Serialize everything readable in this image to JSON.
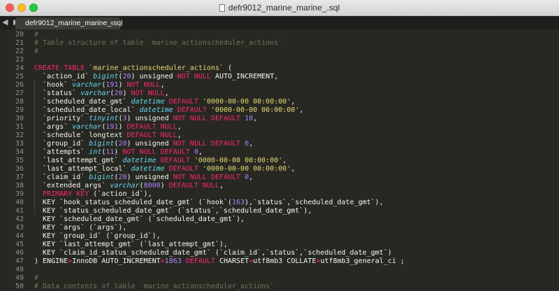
{
  "window": {
    "title": "defr9012_marine_marine_.sql",
    "tab_label": "defr9012_marine_marine_.sql",
    "tab_close": "×",
    "nav_arrows": "◀ ▶"
  },
  "colors": {
    "background": "#272822",
    "comment": "#75715e",
    "keyword": "#f92672",
    "type": "#66d9ef",
    "number": "#ae81ff",
    "string": "#e6db74",
    "text": "#f8f8f2",
    "line_number": "#90908a"
  },
  "code_lines": [
    {
      "n": "20",
      "tokens": [
        {
          "c": "comment",
          "t": "#"
        }
      ]
    },
    {
      "n": "21",
      "tokens": [
        {
          "c": "comment",
          "t": "# Table structure of table `marine_actionscheduler_actions`"
        }
      ]
    },
    {
      "n": "22",
      "tokens": [
        {
          "c": "comment",
          "t": "#"
        }
      ]
    },
    {
      "n": "23",
      "tokens": []
    },
    {
      "n": "24",
      "tokens": [
        {
          "c": "kw",
          "t": "CREATE TABLE "
        },
        {
          "c": "str",
          "t": "`marine_actionscheduler_actions`"
        },
        {
          "c": "plain",
          "t": " ("
        }
      ]
    },
    {
      "n": "25",
      "tokens": [
        {
          "c": "plain",
          "t": "  `action_id` "
        },
        {
          "c": "type",
          "t": "bigint"
        },
        {
          "c": "plain",
          "t": "("
        },
        {
          "c": "num",
          "t": "20"
        },
        {
          "c": "plain",
          "t": ") unsigned "
        },
        {
          "c": "kw",
          "t": "NOT NULL"
        },
        {
          "c": "plain",
          "t": " AUTO_INCREMENT,"
        }
      ]
    },
    {
      "n": "26",
      "tokens": [
        {
          "c": "plain",
          "t": "  `hook` "
        },
        {
          "c": "type",
          "t": "varchar"
        },
        {
          "c": "plain",
          "t": "("
        },
        {
          "c": "num",
          "t": "191"
        },
        {
          "c": "plain",
          "t": ") "
        },
        {
          "c": "kw",
          "t": "NOT NULL"
        },
        {
          "c": "plain",
          "t": ","
        }
      ]
    },
    {
      "n": "27",
      "tokens": [
        {
          "c": "plain",
          "t": "  `status` "
        },
        {
          "c": "type",
          "t": "varchar"
        },
        {
          "c": "plain",
          "t": "("
        },
        {
          "c": "num",
          "t": "20"
        },
        {
          "c": "plain",
          "t": ") "
        },
        {
          "c": "kw",
          "t": "NOT NULL"
        },
        {
          "c": "plain",
          "t": ","
        }
      ]
    },
    {
      "n": "28",
      "tokens": [
        {
          "c": "plain",
          "t": "  `scheduled_date_gmt` "
        },
        {
          "c": "type",
          "t": "datetime"
        },
        {
          "c": "plain",
          "t": " "
        },
        {
          "c": "kw",
          "t": "DEFAULT"
        },
        {
          "c": "plain",
          "t": " "
        },
        {
          "c": "str",
          "t": "'0000-00-00 00:00:00'"
        },
        {
          "c": "plain",
          "t": ","
        }
      ]
    },
    {
      "n": "29",
      "tokens": [
        {
          "c": "plain",
          "t": "  `scheduled_date_local` "
        },
        {
          "c": "type",
          "t": "datetime"
        },
        {
          "c": "plain",
          "t": " "
        },
        {
          "c": "kw",
          "t": "DEFAULT"
        },
        {
          "c": "plain",
          "t": " "
        },
        {
          "c": "str",
          "t": "'0000-00-00 00:00:00'"
        },
        {
          "c": "plain",
          "t": ","
        }
      ]
    },
    {
      "n": "30",
      "tokens": [
        {
          "c": "plain",
          "t": "  `priority` "
        },
        {
          "c": "type",
          "t": "tinyint"
        },
        {
          "c": "plain",
          "t": "("
        },
        {
          "c": "num",
          "t": "3"
        },
        {
          "c": "plain",
          "t": ") unsigned "
        },
        {
          "c": "kw",
          "t": "NOT NULL DEFAULT"
        },
        {
          "c": "plain",
          "t": " "
        },
        {
          "c": "num",
          "t": "10"
        },
        {
          "c": "plain",
          "t": ","
        }
      ]
    },
    {
      "n": "31",
      "tokens": [
        {
          "c": "plain",
          "t": "  `args` "
        },
        {
          "c": "type",
          "t": "varchar"
        },
        {
          "c": "plain",
          "t": "("
        },
        {
          "c": "num",
          "t": "191"
        },
        {
          "c": "plain",
          "t": ") "
        },
        {
          "c": "kw",
          "t": "DEFAULT NULL"
        },
        {
          "c": "plain",
          "t": ","
        }
      ]
    },
    {
      "n": "32",
      "tokens": [
        {
          "c": "plain",
          "t": "  `schedule` longtext "
        },
        {
          "c": "kw",
          "t": "DEFAULT NULL"
        },
        {
          "c": "plain",
          "t": ","
        }
      ]
    },
    {
      "n": "33",
      "tokens": [
        {
          "c": "plain",
          "t": "  `group_id` "
        },
        {
          "c": "type",
          "t": "bigint"
        },
        {
          "c": "plain",
          "t": "("
        },
        {
          "c": "num",
          "t": "20"
        },
        {
          "c": "plain",
          "t": ") unsigned "
        },
        {
          "c": "kw",
          "t": "NOT NULL DEFAULT"
        },
        {
          "c": "plain",
          "t": " "
        },
        {
          "c": "num",
          "t": "0"
        },
        {
          "c": "plain",
          "t": ","
        }
      ]
    },
    {
      "n": "34",
      "tokens": [
        {
          "c": "plain",
          "t": "  `attempts` "
        },
        {
          "c": "type",
          "t": "int"
        },
        {
          "c": "plain",
          "t": "("
        },
        {
          "c": "num",
          "t": "11"
        },
        {
          "c": "plain",
          "t": ") "
        },
        {
          "c": "kw",
          "t": "NOT NULL DEFAULT"
        },
        {
          "c": "plain",
          "t": " "
        },
        {
          "c": "num",
          "t": "0"
        },
        {
          "c": "plain",
          "t": ","
        }
      ]
    },
    {
      "n": "35",
      "tokens": [
        {
          "c": "plain",
          "t": "  `last_attempt_gmt` "
        },
        {
          "c": "type",
          "t": "datetime"
        },
        {
          "c": "plain",
          "t": " "
        },
        {
          "c": "kw",
          "t": "DEFAULT"
        },
        {
          "c": "plain",
          "t": " "
        },
        {
          "c": "str",
          "t": "'0000-00-00 00:00:00'"
        },
        {
          "c": "plain",
          "t": ","
        }
      ]
    },
    {
      "n": "36",
      "tokens": [
        {
          "c": "plain",
          "t": "  `last_attempt_local` "
        },
        {
          "c": "type",
          "t": "datetime"
        },
        {
          "c": "plain",
          "t": " "
        },
        {
          "c": "kw",
          "t": "DEFAULT"
        },
        {
          "c": "plain",
          "t": " "
        },
        {
          "c": "str",
          "t": "'0000-00-00 00:00:00'"
        },
        {
          "c": "plain",
          "t": ","
        }
      ]
    },
    {
      "n": "37",
      "tokens": [
        {
          "c": "plain",
          "t": "  `claim_id` "
        },
        {
          "c": "type",
          "t": "bigint"
        },
        {
          "c": "plain",
          "t": "("
        },
        {
          "c": "num",
          "t": "20"
        },
        {
          "c": "plain",
          "t": ") unsigned "
        },
        {
          "c": "kw",
          "t": "NOT NULL DEFAULT"
        },
        {
          "c": "plain",
          "t": " "
        },
        {
          "c": "num",
          "t": "0"
        },
        {
          "c": "plain",
          "t": ","
        }
      ]
    },
    {
      "n": "38",
      "tokens": [
        {
          "c": "plain",
          "t": "  `extended_args` "
        },
        {
          "c": "type",
          "t": "varchar"
        },
        {
          "c": "plain",
          "t": "("
        },
        {
          "c": "num",
          "t": "8000"
        },
        {
          "c": "plain",
          "t": ") "
        },
        {
          "c": "kw",
          "t": "DEFAULT NULL"
        },
        {
          "c": "plain",
          "t": ","
        }
      ]
    },
    {
      "n": "39",
      "tokens": [
        {
          "c": "plain",
          "t": "  "
        },
        {
          "c": "kw",
          "t": "PRIMARY KEY"
        },
        {
          "c": "plain",
          "t": " (`action_id`),"
        }
      ]
    },
    {
      "n": "40",
      "tokens": [
        {
          "c": "plain",
          "t": "  KEY `hook_status_scheduled_date_gmt` (`hook`("
        },
        {
          "c": "num",
          "t": "163"
        },
        {
          "c": "plain",
          "t": "),`status`,`scheduled_date_gmt`),"
        }
      ]
    },
    {
      "n": "41",
      "tokens": [
        {
          "c": "plain",
          "t": "  KEY `status_scheduled_date_gmt` (`status`,`scheduled_date_gmt`),"
        }
      ]
    },
    {
      "n": "42",
      "tokens": [
        {
          "c": "plain",
          "t": "  KEY `scheduled_date_gmt` (`scheduled_date_gmt`),"
        }
      ]
    },
    {
      "n": "43",
      "tokens": [
        {
          "c": "plain",
          "t": "  KEY `args` (`args`),"
        }
      ]
    },
    {
      "n": "44",
      "tokens": [
        {
          "c": "plain",
          "t": "  KEY `group_id` (`group_id`),"
        }
      ]
    },
    {
      "n": "45",
      "tokens": [
        {
          "c": "plain",
          "t": "  KEY `last_attempt_gmt` (`last_attempt_gmt`),"
        }
      ]
    },
    {
      "n": "46",
      "tokens": [
        {
          "c": "plain",
          "t": "  KEY `claim_id_status_scheduled_date_gmt` (`claim_id`,`status`,`scheduled_date_gmt`)"
        }
      ]
    },
    {
      "n": "47",
      "tokens": [
        {
          "c": "plain",
          "t": ") ENGINE"
        },
        {
          "c": "kw",
          "t": "="
        },
        {
          "c": "plain",
          "t": "InnoDB AUTO_INCREMENT"
        },
        {
          "c": "kw",
          "t": "="
        },
        {
          "c": "num",
          "t": "1863"
        },
        {
          "c": "plain",
          "t": " "
        },
        {
          "c": "kw",
          "t": "DEFAULT"
        },
        {
          "c": "plain",
          "t": " CHARSET"
        },
        {
          "c": "kw",
          "t": "="
        },
        {
          "c": "plain",
          "t": "utf8mb3 COLLATE"
        },
        {
          "c": "kw",
          "t": "="
        },
        {
          "c": "plain",
          "t": "utf8mb3_general_ci ;"
        }
      ]
    },
    {
      "n": "48",
      "tokens": []
    },
    {
      "n": "49",
      "tokens": [
        {
          "c": "comment",
          "t": "#"
        }
      ]
    },
    {
      "n": "50",
      "tokens": [
        {
          "c": "comment",
          "t": "# Data contents of table `marine_actionscheduler_actions`"
        }
      ]
    }
  ]
}
